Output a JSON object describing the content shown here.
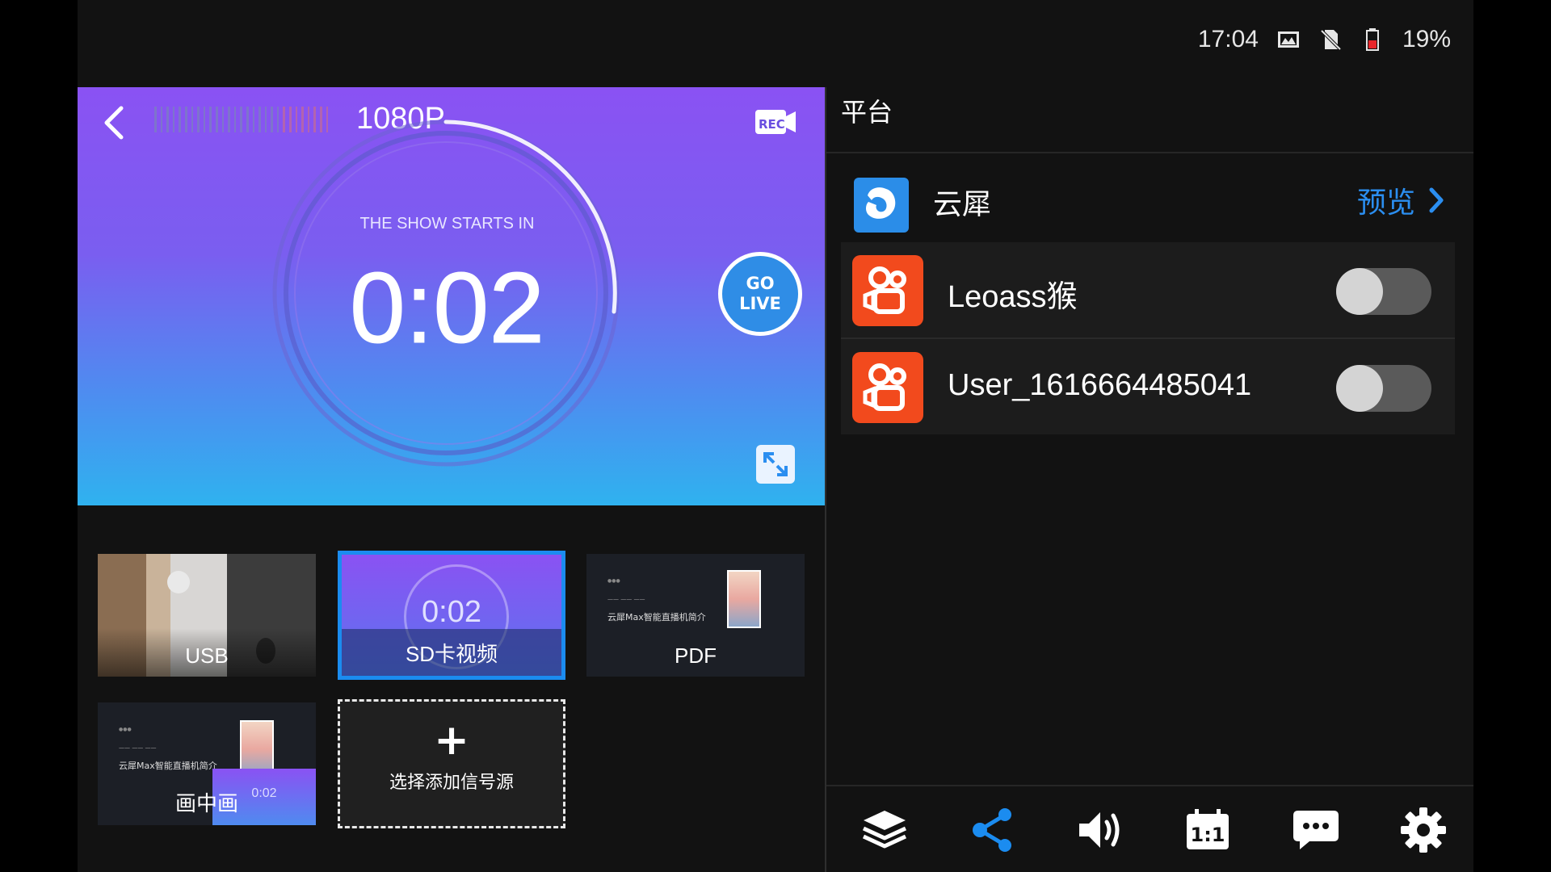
{
  "status_bar": {
    "time": "17:04",
    "battery_percent": "19%",
    "icons": [
      "image-icon",
      "no-sim-icon",
      "battery-low-icon"
    ],
    "battery_level": 0.19,
    "battery_color": "#e8262b"
  },
  "preview": {
    "resolution": "1080P",
    "countdown_label": "THE SHOW STARTS IN",
    "countdown": "0:02",
    "go_live_line1": "GO",
    "go_live_line2": "LIVE",
    "rec_text": "REC",
    "gradient_colors": [
      "#8a52f3",
      "#2fb2ef"
    ]
  },
  "sources": [
    {
      "label": "USB"
    },
    {
      "label": "SD卡视频",
      "selected": true,
      "thumb_time": "0:02"
    },
    {
      "label": "PDF",
      "doc_title": "云犀Max智能直播机简介"
    },
    {
      "label": "画中画",
      "doc_title": "云犀Max智能直播机简介",
      "inset_time": "0:02"
    },
    {
      "label": "选择添加信号源",
      "icon": "plus-icon"
    }
  ],
  "platform_panel": {
    "title": "平台",
    "main_platform": {
      "name": "云犀",
      "action": "预览"
    },
    "accounts": [
      {
        "name": "Leoass猴",
        "enabled": false
      },
      {
        "name": "User_1616664485041",
        "enabled": false
      }
    ]
  },
  "toolbar": {
    "buttons": [
      "layers-icon",
      "share-icon",
      "volume-icon",
      "aspect-ratio-icon",
      "chat-icon",
      "settings-icon"
    ],
    "active": "share-icon",
    "aspect_text": "1:1",
    "accent_color": "#1b8cf0"
  }
}
